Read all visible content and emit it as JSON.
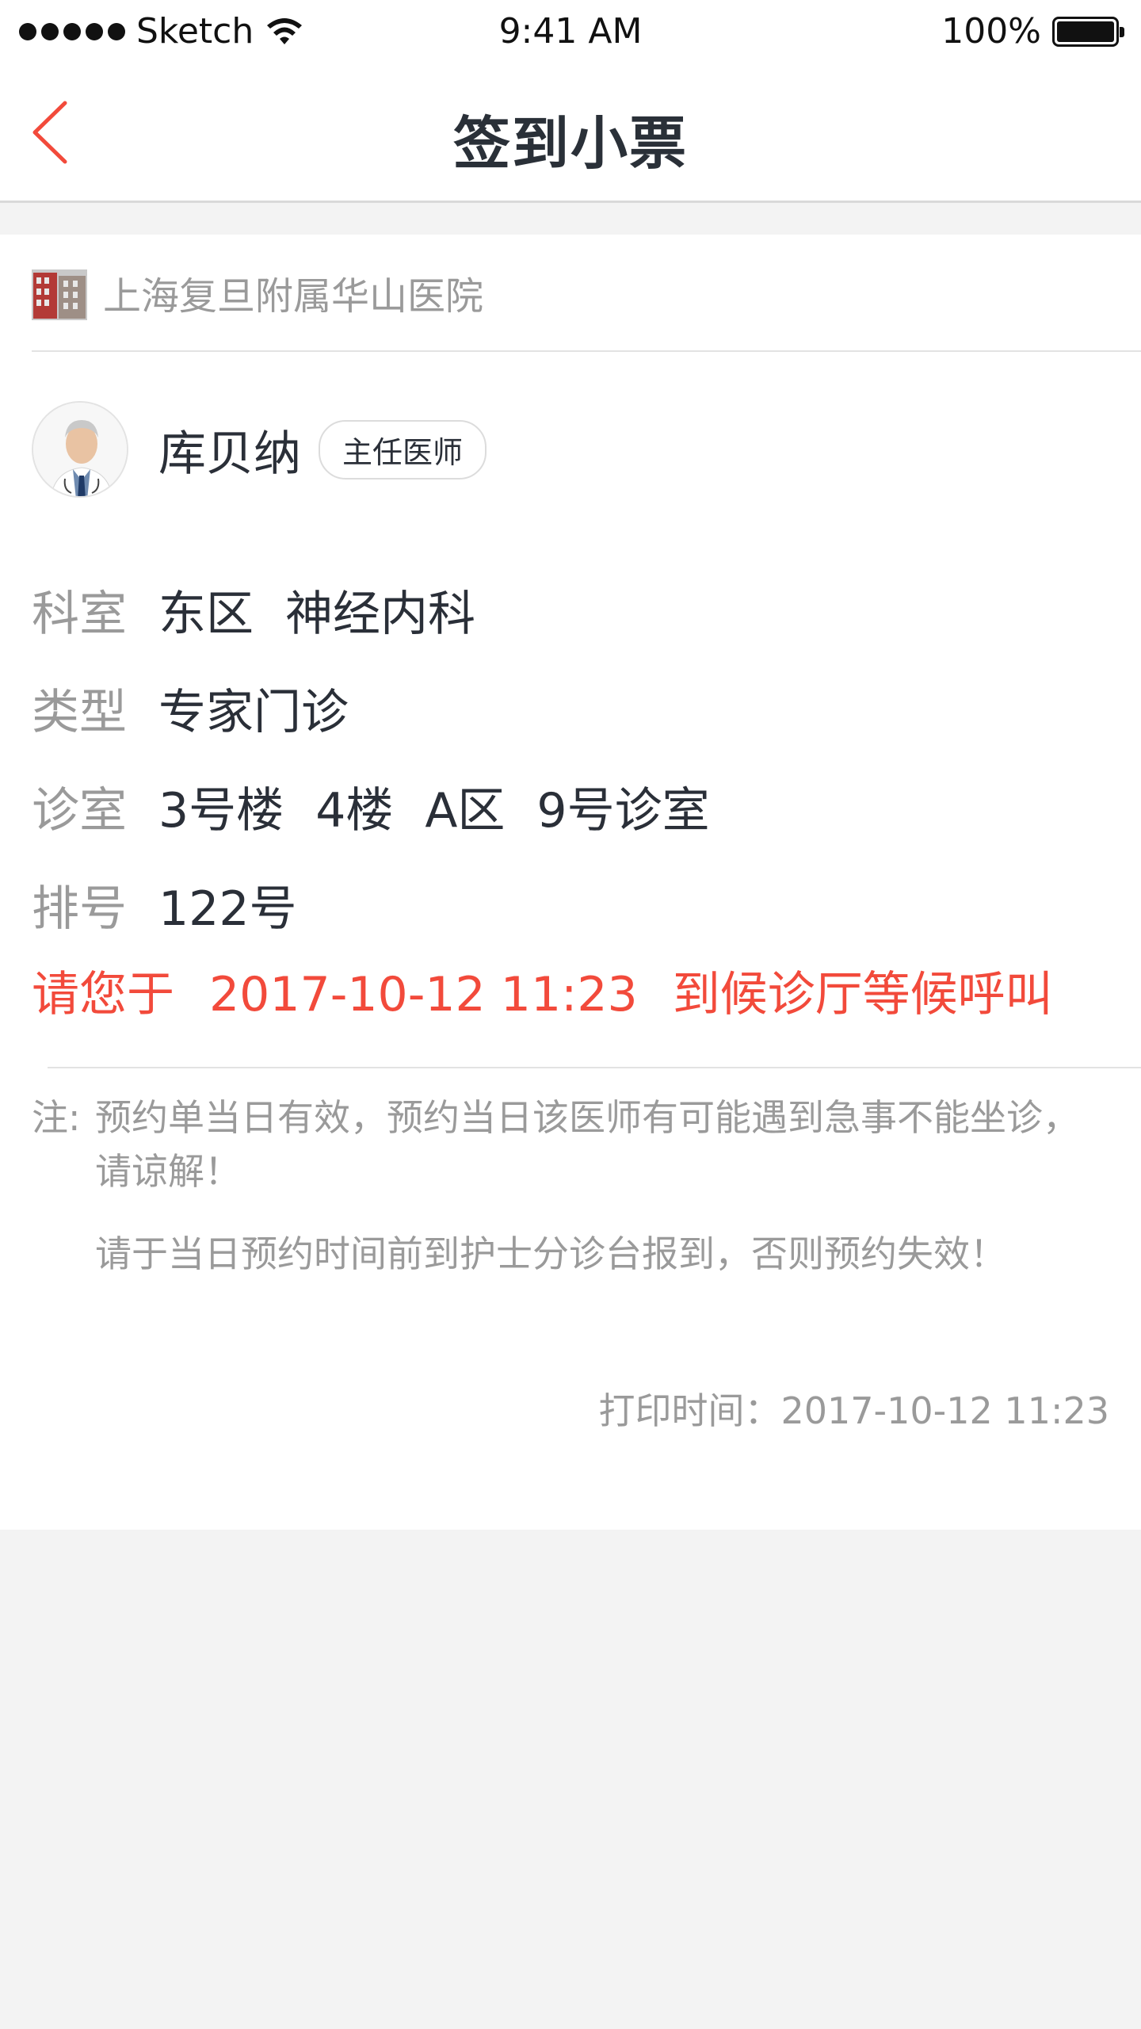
{
  "status_bar": {
    "carrier": "Sketch",
    "time": "9:41 AM",
    "battery": "100%"
  },
  "nav": {
    "title": "签到小票"
  },
  "hospital": {
    "name": "上海复旦附属华山医院"
  },
  "doctor": {
    "name": "库贝纳",
    "title": "主任医师"
  },
  "info": {
    "department_label": "科室",
    "department_area": "东区",
    "department_name": "神经内科",
    "type_label": "类型",
    "type_value": "专家门诊",
    "room_label": "诊室",
    "room_building": "3号楼",
    "room_floor": "4楼",
    "room_zone": "A区",
    "room_number": "9号诊室",
    "queue_label": "排号",
    "queue_value": "122号"
  },
  "notice": {
    "prefix": "请您于",
    "datetime": "2017-10-12 11:23",
    "suffix": "到候诊厅等候呼叫"
  },
  "notes": {
    "prefix": "注:",
    "line1": "预约单当日有效，预约当日该医师有可能遇到急事不能坐诊，请谅解！",
    "line2": "请于当日预约时间前到护士分诊台报到，否则预约失效！"
  },
  "print_time": "打印时间：2017-10-12 11:23",
  "colors": {
    "accent": "#f24a3b",
    "text_primary": "#2a2f38",
    "text_secondary": "#9a9a9a",
    "background": "#f3f3f3"
  }
}
